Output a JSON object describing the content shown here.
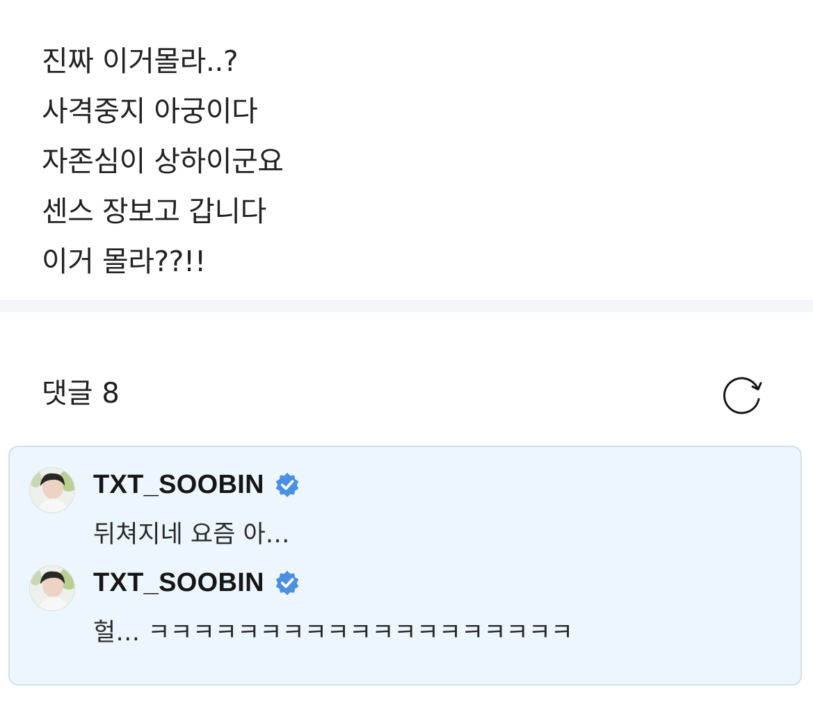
{
  "post": {
    "lines": [
      "진짜 이거몰라..?",
      "사격중지 아궁이다",
      "자존심이 상하이군요",
      "센스 장보고 갑니다",
      "이거 몰라??!!"
    ]
  },
  "comments_section": {
    "title": "댓글 8",
    "refresh_icon": "refresh-icon",
    "accent_color": "#4a90e2",
    "box_background": "#edf6fd",
    "comments": [
      {
        "author": "TXT_SOOBIN",
        "verified": true,
        "text": "뒤쳐지네 요즘 아…"
      },
      {
        "author": "TXT_SOOBIN",
        "verified": true,
        "text": "헐… ㅋㅋㅋㅋㅋㅋㅋㅋㅋㅋㅋㅋㅋㅋㅋㅋㅋㅋㅋ"
      }
    ]
  }
}
